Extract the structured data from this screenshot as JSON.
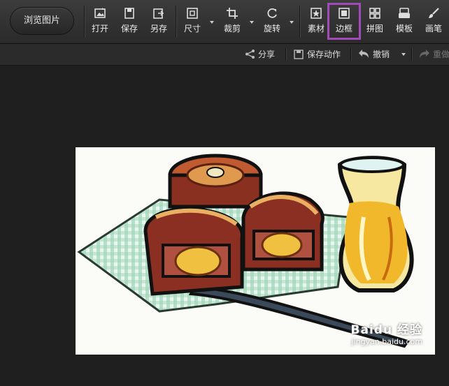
{
  "toolbar": {
    "browse_label": "浏览图片",
    "tools": [
      {
        "label": "打开",
        "icon": "open-image-icon"
      },
      {
        "label": "保存",
        "icon": "save-icon"
      },
      {
        "label": "另存",
        "icon": "save-as-icon"
      },
      {
        "label": "尺寸",
        "icon": "resize-icon"
      },
      {
        "label": "裁剪",
        "icon": "crop-icon"
      },
      {
        "label": "旋转",
        "icon": "rotate-icon"
      },
      {
        "label": "素材",
        "icon": "sticker-icon"
      },
      {
        "label": "边框",
        "icon": "frame-icon"
      },
      {
        "label": "拼图",
        "icon": "collage-icon"
      },
      {
        "label": "模板",
        "icon": "template-icon"
      },
      {
        "label": "画笔",
        "icon": "brush-icon"
      }
    ],
    "highlighted_tool": "边框",
    "highlight_color": "#a04bb8"
  },
  "subbar": {
    "share_label": "分享",
    "save_action_label": "保存动作",
    "undo_label": "撤销",
    "redo_label": "重做"
  },
  "canvas": {
    "image_description_icon": "mooncake-tea-illustration"
  },
  "watermark": {
    "brand": "Baidu 经验",
    "url": "jingyan.baidu.com"
  }
}
